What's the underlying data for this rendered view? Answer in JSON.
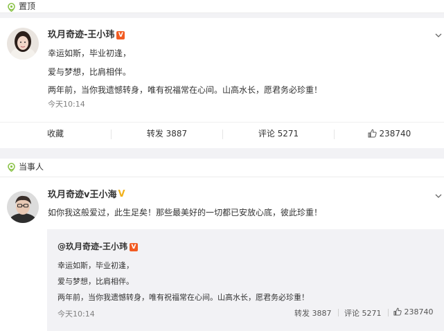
{
  "pinned_label": "置顶",
  "post1": {
    "author": "玖月奇迹-王小玮",
    "badge": "V",
    "lines": [
      "幸运如斯，毕业初逢，",
      "爱与梦想，比肩相伴。",
      "两年前，当你我遗憾转身，唯有祝福常在心间。山高水长，愿君务必珍重！"
    ],
    "time": "今天10:14",
    "actions": {
      "favorite": "收藏",
      "repost": "转发 3887",
      "comment": "评论 5271",
      "like": "238740"
    }
  },
  "party_label": "当事人",
  "post2": {
    "author": "玖月奇迹v王小海",
    "badge": "V",
    "text": "如你我这般爱过，此生足矣！那些最美好的一切都已安放心底，彼此珍重！",
    "quoted": {
      "author": "@玖月奇迹-王小玮",
      "badge": "V",
      "lines": [
        "幸运如斯，毕业初逢，",
        "爱与梦想，比肩相伴。",
        "两年前，当你我遗憾转身，唯有祝福常在心间。山高水长，愿君务必珍重！"
      ],
      "time": "今天10:14",
      "repost": "转发 3887",
      "comment": "评论 5271",
      "like": "238740"
    }
  },
  "colors": {
    "accent_green": "#8bc34a",
    "badge_orange": "#f25b22",
    "badge_yellow": "#f1b11c"
  },
  "icons": [
    "location-pin-icon",
    "chevron-down-icon",
    "thumbs-up-icon",
    "verified-badge-icon"
  ]
}
